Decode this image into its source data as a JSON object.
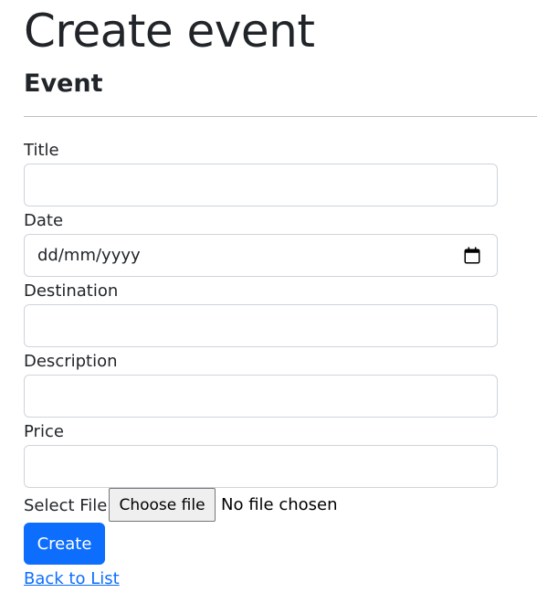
{
  "page": {
    "title": "Create event",
    "section_title": "Event"
  },
  "form": {
    "title": {
      "label": "Title",
      "value": "",
      "placeholder": ""
    },
    "date": {
      "label": "Date",
      "placeholder_text": "dd/mm/yyyy",
      "icon": "calendar-icon"
    },
    "destination": {
      "label": "Destination",
      "value": "",
      "placeholder": ""
    },
    "description": {
      "label": "Description",
      "value": "",
      "placeholder": ""
    },
    "price": {
      "label": "Price",
      "value": "",
      "placeholder": ""
    },
    "file": {
      "label": "Select File",
      "button_label": "Choose file",
      "status": "No file chosen"
    },
    "submit_label": "Create"
  },
  "links": {
    "back": "Back to List"
  },
  "colors": {
    "primary": "#0d6efd",
    "text": "#212529",
    "border": "#ced4da"
  }
}
